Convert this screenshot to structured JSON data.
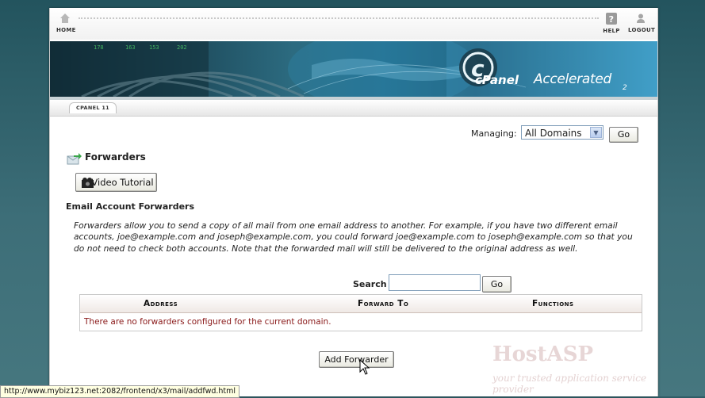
{
  "nav": {
    "home_label": "HOME",
    "help_label": "HELP",
    "logout_label": "LOGOUT"
  },
  "banner": {
    "brand_cpanel": "cPanel",
    "brand_accelerated": "Accelerated",
    "brand_version": "2",
    "tab_label": "CPANEL 11"
  },
  "managing": {
    "label": "Managing:",
    "selected": "All Domains",
    "go_label": "Go"
  },
  "page": {
    "title": "Forwarders",
    "video_button": "Video Tutorial",
    "section_heading": "Email Account Forwarders",
    "description": "Forwarders allow you to send a copy of all mail from one email address to another. For example, if you have two different email accounts, joe@example.com and joseph@example.com, you could forward joe@example.com to joseph@example.com so that you do not need to check both accounts. Note that the forwarded mail will still be delivered to the original address as well."
  },
  "search": {
    "label": "Search",
    "value": "",
    "go_label": "Go"
  },
  "table": {
    "columns": [
      "Address",
      "Forward To",
      "Functions"
    ],
    "empty_message": "There are no forwarders configured for the current domain."
  },
  "add_button": "Add Forwarder",
  "watermark": {
    "title": "HostASP",
    "tagline": "your trusted application service provider"
  },
  "statusbar": "http://www.mybiz123.net:2082/frontend/x3/mail/addfwd.html",
  "colors": {
    "empty_message": "#8a1a1a",
    "background": "#2f5d66"
  }
}
